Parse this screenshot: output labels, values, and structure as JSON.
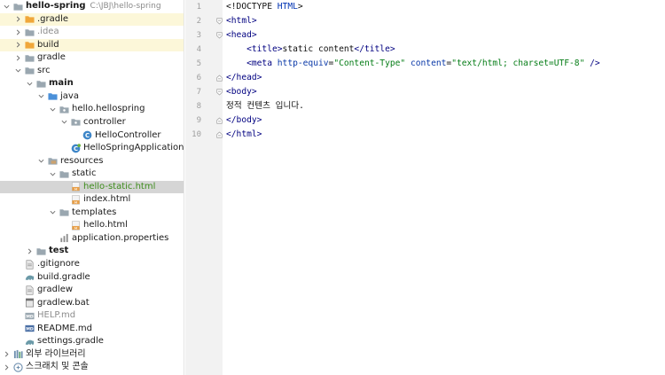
{
  "project": {
    "name": "hello-spring",
    "path": "C:\\JBJ\\hello-spring"
  },
  "tree": [
    {
      "label": "hello-spring",
      "indent": 0,
      "arrow": "down",
      "icon": "folder-icon",
      "iconColor": "#9aa7b0",
      "style": "bold",
      "path": true,
      "name": "tree-item-hello-spring"
    },
    {
      "label": ".gradle",
      "indent": 1,
      "arrow": "right",
      "icon": "folder-icon",
      "iconColor": "#f0a73a",
      "style": "",
      "row": "hl",
      "name": "tree-item-gradle-cache"
    },
    {
      "label": ".idea",
      "indent": 1,
      "arrow": "right",
      "icon": "folder-icon",
      "iconColor": "#9aa7b0",
      "style": "gray",
      "name": "tree-item-idea"
    },
    {
      "label": "build",
      "indent": 1,
      "arrow": "right",
      "icon": "folder-icon",
      "iconColor": "#f0a73a",
      "style": "",
      "row": "hl",
      "name": "tree-item-build"
    },
    {
      "label": "gradle",
      "indent": 1,
      "arrow": "right",
      "icon": "folder-icon",
      "iconColor": "#9aa7b0",
      "style": "",
      "name": "tree-item-gradle"
    },
    {
      "label": "src",
      "indent": 1,
      "arrow": "down",
      "icon": "folder-icon",
      "iconColor": "#9aa7b0",
      "style": "",
      "name": "tree-item-src"
    },
    {
      "label": "main",
      "indent": 2,
      "arrow": "down",
      "icon": "folder-icon",
      "iconColor": "#9aa7b0",
      "style": "bold",
      "name": "tree-item-main"
    },
    {
      "label": "java",
      "indent": 3,
      "arrow": "down",
      "icon": "folder-icon",
      "iconColor": "#4a90d9",
      "style": "",
      "name": "tree-item-java"
    },
    {
      "label": "hello.hellospring",
      "indent": 4,
      "arrow": "down",
      "icon": "package-icon",
      "iconColor": "#9aa7b0",
      "style": "",
      "name": "tree-item-package"
    },
    {
      "label": "controller",
      "indent": 5,
      "arrow": "down",
      "icon": "package-icon",
      "iconColor": "#9aa7b0",
      "style": "",
      "name": "tree-item-controller"
    },
    {
      "label": "HelloController",
      "indent": 6,
      "arrow": "none",
      "icon": "class-icon",
      "iconColor": "#3e86c8",
      "style": "",
      "name": "tree-item-hello-controller"
    },
    {
      "label": "HelloSpringApplication",
      "indent": 5,
      "arrow": "none",
      "icon": "spring-class-icon",
      "iconColor": "#3e86c8",
      "style": "",
      "name": "tree-item-hello-spring-application"
    },
    {
      "label": "resources",
      "indent": 3,
      "arrow": "down",
      "icon": "resources-folder-icon",
      "iconColor": "#9aa7b0",
      "style": "",
      "name": "tree-item-resources"
    },
    {
      "label": "static",
      "indent": 4,
      "arrow": "down",
      "icon": "folder-icon",
      "iconColor": "#9aa7b0",
      "style": "",
      "name": "tree-item-static"
    },
    {
      "label": "hello-static.html",
      "indent": 5,
      "arrow": "none",
      "icon": "html-file-icon",
      "iconColor": "#e8a04a",
      "style": "green",
      "row": "sel",
      "name": "tree-item-hello-static-html"
    },
    {
      "label": "index.html",
      "indent": 5,
      "arrow": "none",
      "icon": "html-file-icon",
      "iconColor": "#e8a04a",
      "style": "",
      "name": "tree-item-index-html"
    },
    {
      "label": "templates",
      "indent": 4,
      "arrow": "down",
      "icon": "folder-icon",
      "iconColor": "#9aa7b0",
      "style": "",
      "name": "tree-item-templates"
    },
    {
      "label": "hello.html",
      "indent": 5,
      "arrow": "none",
      "icon": "html-file-icon",
      "iconColor": "#e8a04a",
      "style": "",
      "name": "tree-item-hello-html"
    },
    {
      "label": "application.properties",
      "indent": 4,
      "arrow": "none",
      "icon": "properties-file-icon",
      "iconColor": "#8c8c8c",
      "style": "",
      "name": "tree-item-application-properties"
    },
    {
      "label": "test",
      "indent": 2,
      "arrow": "right",
      "icon": "folder-icon",
      "iconColor": "#9aa7b0",
      "style": "bold",
      "name": "tree-item-test"
    },
    {
      "label": ".gitignore",
      "indent": 1,
      "arrow": "none",
      "icon": "file-icon",
      "iconColor": "#8c8c8c",
      "style": "",
      "name": "tree-item-gitignore"
    },
    {
      "label": "build.gradle",
      "indent": 1,
      "arrow": "none",
      "icon": "gradle-icon",
      "iconColor": "#6b9aa8",
      "style": "",
      "name": "tree-item-build-gradle"
    },
    {
      "label": "gradlew",
      "indent": 1,
      "arrow": "none",
      "icon": "file-icon",
      "iconColor": "#8c8c8c",
      "style": "",
      "name": "tree-item-gradlew"
    },
    {
      "label": "gradlew.bat",
      "indent": 1,
      "arrow": "none",
      "icon": "bat-file-icon",
      "iconColor": "#6e6e6e",
      "style": "",
      "name": "tree-item-gradlew-bat"
    },
    {
      "label": "HELP.md",
      "indent": 1,
      "arrow": "none",
      "icon": "markdown-icon",
      "iconColor": "#9aa7b0",
      "style": "gray",
      "name": "tree-item-help-md"
    },
    {
      "label": "README.md",
      "indent": 1,
      "arrow": "none",
      "icon": "markdown-icon",
      "iconColor": "#4a6fa5",
      "style": "",
      "name": "tree-item-readme-md"
    },
    {
      "label": "settings.gradle",
      "indent": 1,
      "arrow": "none",
      "icon": "gradle-icon",
      "iconColor": "#6b9aa8",
      "style": "",
      "name": "tree-item-settings-gradle"
    },
    {
      "label": "외부 라이브러리",
      "indent": 0,
      "arrow": "right",
      "icon": "library-icon",
      "iconColor": "#6e8faf",
      "style": "",
      "name": "tree-item-external-libraries"
    },
    {
      "label": "스크래치 및 콘솔",
      "indent": 0,
      "arrow": "right",
      "icon": "scratch-icon",
      "iconColor": "#6e8faf",
      "style": "",
      "name": "tree-item-scratches"
    }
  ],
  "editor": {
    "lines": [
      {
        "num": "1",
        "fold": "",
        "parts": [
          {
            "t": "<!DOCTYPE ",
            "c": ""
          },
          {
            "t": "HTML",
            "c": "dt"
          },
          {
            "t": ">",
            "c": ""
          }
        ]
      },
      {
        "num": "2",
        "fold": "open",
        "parts": [
          {
            "t": "<html>",
            "c": "tg"
          }
        ]
      },
      {
        "num": "3",
        "fold": "open",
        "parts": [
          {
            "t": "<head>",
            "c": "tg"
          }
        ]
      },
      {
        "num": "4",
        "fold": "",
        "parts": [
          {
            "t": "    ",
            "c": ""
          },
          {
            "t": "<title>",
            "c": "tg"
          },
          {
            "t": "static content",
            "c": ""
          },
          {
            "t": "</title>",
            "c": "tg"
          }
        ]
      },
      {
        "num": "5",
        "fold": "",
        "parts": [
          {
            "t": "    ",
            "c": ""
          },
          {
            "t": "<meta ",
            "c": "tg"
          },
          {
            "t": "http-equiv",
            "c": "at"
          },
          {
            "t": "=",
            "c": ""
          },
          {
            "t": "\"Content-Type\"",
            "c": "st"
          },
          {
            "t": " ",
            "c": ""
          },
          {
            "t": "content",
            "c": "at"
          },
          {
            "t": "=",
            "c": ""
          },
          {
            "t": "\"text/html; charset=UTF-8\"",
            "c": "st"
          },
          {
            "t": " />",
            "c": "tg"
          }
        ]
      },
      {
        "num": "6",
        "fold": "close",
        "parts": [
          {
            "t": "</head>",
            "c": "tg"
          }
        ]
      },
      {
        "num": "7",
        "fold": "open",
        "parts": [
          {
            "t": "<body>",
            "c": "tg"
          }
        ]
      },
      {
        "num": "8",
        "fold": "",
        "parts": [
          {
            "t": "정적 컨텐츠 입니다.",
            "c": ""
          }
        ]
      },
      {
        "num": "9",
        "fold": "close",
        "parts": [
          {
            "t": "</body>",
            "c": "tg"
          }
        ]
      },
      {
        "num": "10",
        "fold": "close",
        "parts": [
          {
            "t": "</html>",
            "c": "tg"
          }
        ]
      }
    ]
  }
}
